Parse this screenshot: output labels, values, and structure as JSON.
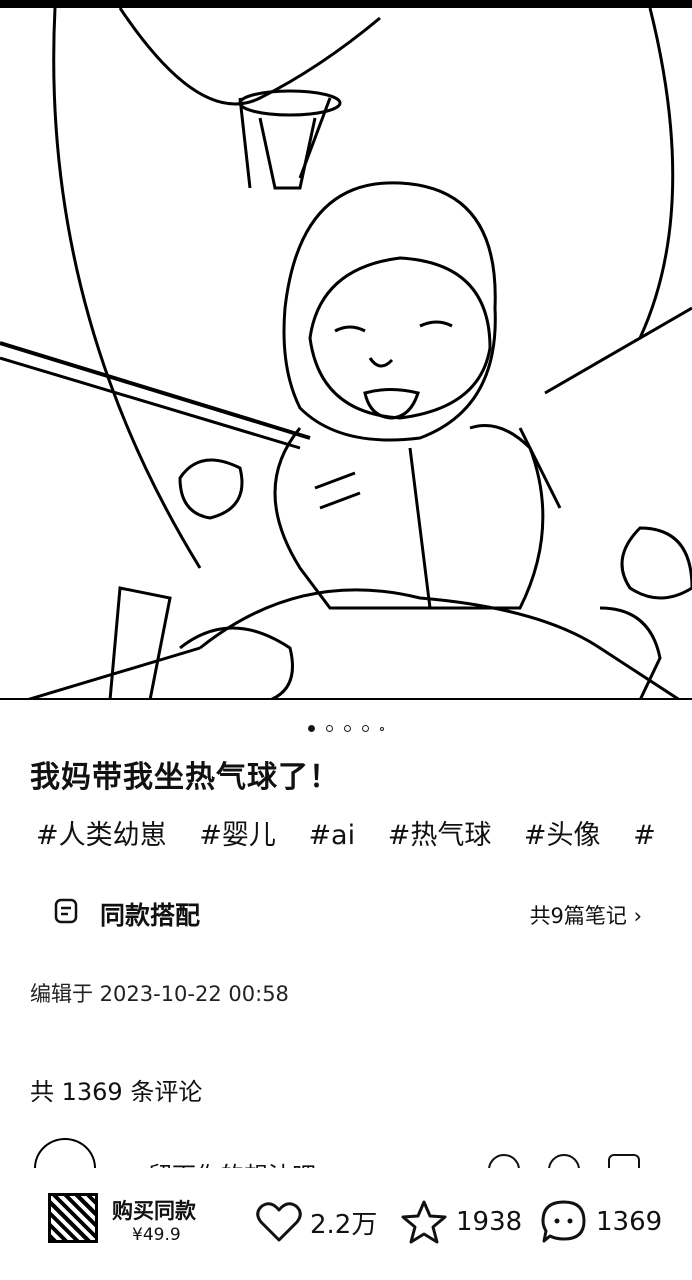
{
  "post": {
    "title": "我妈带我坐热气球了！",
    "tags": [
      "#人类幼崽",
      "#婴儿",
      "#ai",
      "#热气球",
      "#头像",
      "#"
    ],
    "carousel": {
      "pages": 5,
      "current": 1
    }
  },
  "match": {
    "label": "同款搭配",
    "count": "共9篇笔记 ›",
    "icon": "note-icon"
  },
  "edited": "编辑于 2023-10-22 00:58",
  "comments": {
    "header": "共 1369 条评论",
    "placeholder": "留下你的想法吧"
  },
  "bottom_bar": {
    "buy_label": "购买同款",
    "buy_price": "¥49.9",
    "likes": "2.2万",
    "favorites": "1938",
    "comments": "1369"
  }
}
